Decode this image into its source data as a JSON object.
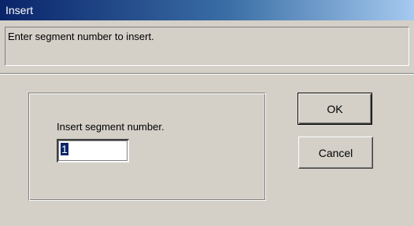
{
  "window": {
    "title": "Insert"
  },
  "prompt": {
    "text": "Enter segment number to insert."
  },
  "form": {
    "label": "Insert segment number.",
    "value": "1"
  },
  "buttons": {
    "ok_label": "OK",
    "cancel_label": "Cancel"
  }
}
